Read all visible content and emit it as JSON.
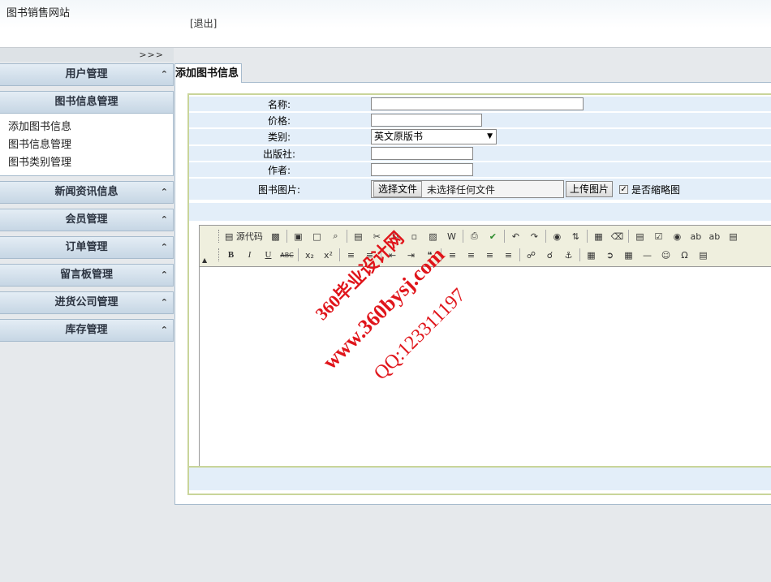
{
  "header": {
    "site_title": "图书销售网站",
    "logout": "[退出]"
  },
  "sidebar": {
    "toggle": ">>>",
    "menus": [
      {
        "label": "用户管理",
        "expanded": false
      },
      {
        "label": "图书信息管理",
        "expanded": true,
        "items": [
          "添加图书信息",
          "图书信息管理",
          "图书类别管理"
        ]
      },
      {
        "label": "新闻资讯信息",
        "expanded": false
      },
      {
        "label": "会员管理",
        "expanded": false
      },
      {
        "label": "订单管理",
        "expanded": false
      },
      {
        "label": "留言板管理",
        "expanded": false
      },
      {
        "label": "进货公司管理",
        "expanded": false
      },
      {
        "label": "库存管理",
        "expanded": false
      }
    ]
  },
  "main": {
    "tab_label": "添加图书信息",
    "form": {
      "name_label": "名称:",
      "name_value": "",
      "price_label": "价格:",
      "price_value": "",
      "category_label": "类别:",
      "category_value": "英文原版书",
      "publisher_label": "出版社:",
      "publisher_value": "",
      "author_label": "作者:",
      "author_value": "",
      "image_label": "图书图片:",
      "choose_file": "选择文件",
      "no_file": "未选择任何文件",
      "upload": "上传图片",
      "thumbnail_label": "是否缩略图",
      "thumbnail_checked": true
    },
    "editor": {
      "source_label": "源代码",
      "toolbar_row1": [
        "source",
        "preview-doc",
        "save",
        "new",
        "print-preview",
        "templates",
        "cut",
        "copy",
        "paste",
        "paste-text",
        "paste-word",
        "print",
        "spellcheck",
        "undo",
        "redo",
        "find",
        "replace",
        "select-all",
        "remove-format",
        "form",
        "checkbox",
        "radio",
        "text-field",
        "textarea",
        "select"
      ],
      "toolbar_row2": [
        "bold",
        "italic",
        "underline",
        "strike",
        "subscript",
        "superscript",
        "ordered-list",
        "unordered-list",
        "outdent",
        "indent",
        "blockquote",
        "align-left",
        "align-center",
        "align-right",
        "justify",
        "link",
        "unlink",
        "anchor",
        "image",
        "flash",
        "table",
        "rule",
        "smiley",
        "special-char",
        "page-break"
      ]
    }
  },
  "watermark": {
    "line1": "360毕业设计网",
    "line2": "www.360bysj.com",
    "line3": "QQ:123311197",
    "color": "#e0151b"
  }
}
